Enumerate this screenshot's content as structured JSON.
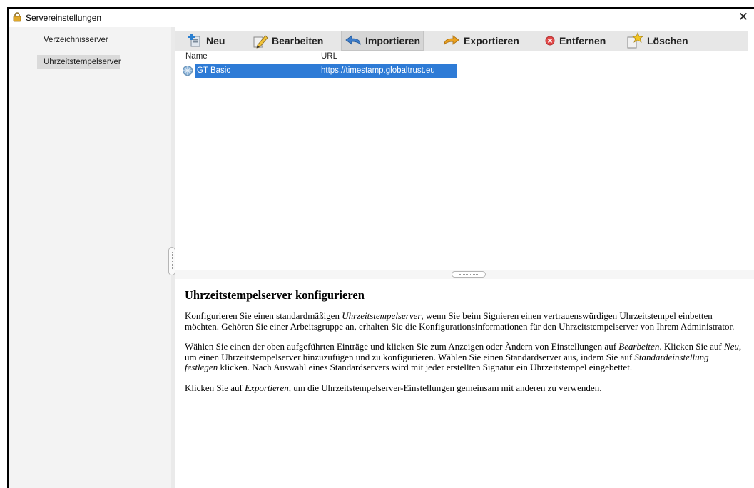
{
  "window": {
    "title": "Servereinstellungen",
    "close_symbol": "✕"
  },
  "sidebar": {
    "items": [
      {
        "label": "Verzeichnisserver",
        "selected": false
      },
      {
        "label": "Uhrzeitstempelserver",
        "selected": true
      }
    ]
  },
  "toolbar": {
    "new_label": "Neu",
    "edit_label": "Bearbeiten",
    "import_label": "Importieren",
    "export_label": "Exportieren",
    "remove_label": "Entfernen",
    "delete_label": "Löschen"
  },
  "list": {
    "columns": [
      "Name",
      "URL"
    ],
    "rows": [
      {
        "name": "GT Basic",
        "url": "https://timestamp.globaltrust.eu"
      }
    ]
  },
  "help": {
    "heading": "Uhrzeitstempelserver konfigurieren",
    "p1": {
      "a": "Konfigurieren Sie einen standardmäßigen ",
      "em1": "Uhrzeitstempelserver",
      "b": ", wenn Sie beim Signieren einen vertrauenswürdigen Uhrzeitstempel einbetten möchten. Gehören Sie einer Arbeitsgruppe an, erhalten Sie die Konfigurationsinformationen für den Uhrzeitstempelserver von Ihrem Administrator."
    },
    "p2": {
      "a": "Wählen Sie einen der oben aufgeführten Einträge und klicken Sie zum Anzeigen oder Ändern von Einstellungen auf ",
      "em1": "Bearbeiten",
      "b": ". Klicken Sie auf ",
      "em2": "Neu",
      "c": ", um einen Uhrzeitstempelserver hinzuzufügen und zu konfigurieren. Wählen Sie einen Standardserver aus, indem Sie auf ",
      "em3": "Standardeinstellung festlegen",
      "d": " klicken. Nach Auswahl eines Standardservers wird mit jeder erstellten Signatur ein Uhrzeitstempel eingebettet."
    },
    "p3": {
      "a": "Klicken Sie auf ",
      "em1": "Exportieren",
      "b": ", um die Uhrzeitstempelserver-Einstellungen gemeinsam mit anderen zu verwenden."
    }
  },
  "colors": {
    "selection": "#2e7bd6",
    "sidebar_bg": "#f3f3f3",
    "toolbar_bg": "#e7e7e7"
  },
  "icons": [
    "lock-icon",
    "close-icon",
    "add-icon",
    "edit-icon",
    "import-icon",
    "export-icon",
    "remove-icon",
    "delete-icon",
    "server-icon"
  ]
}
